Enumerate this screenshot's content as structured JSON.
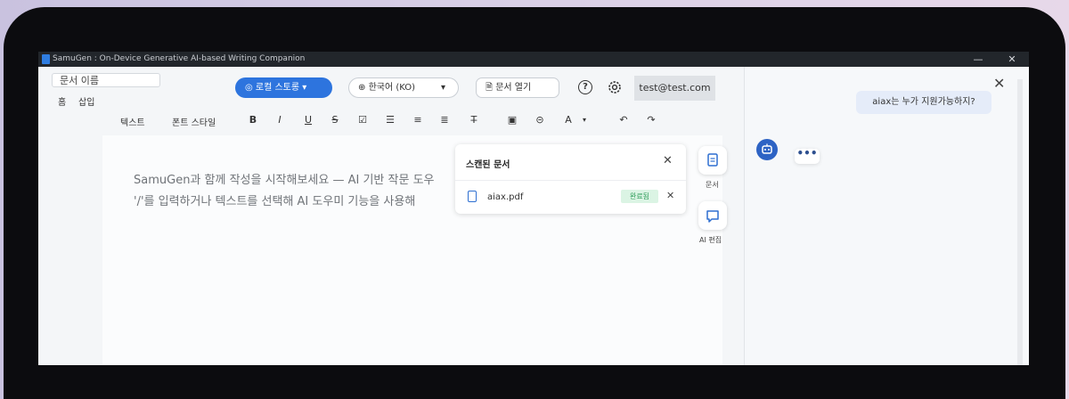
{
  "window": {
    "title": "SamuGen : On-Device Generative AI-based Writing Companion",
    "minimize": "—",
    "maximize": "⧉",
    "close": "✕"
  },
  "header": {
    "doc_name": "문서 이름",
    "menu": [
      "홈",
      "삽입"
    ],
    "storage_label": "로컬 스토롱",
    "language_label": "한국어 (KO)",
    "open_doc_label": "문서 열기",
    "help": "?",
    "account": "test@test.com"
  },
  "toolbar": {
    "text_label": "텍스트",
    "font_style_label": "폰트 스타일",
    "bold": "B",
    "italic": "I",
    "underline": "U",
    "strike": "S",
    "checkbox": "☑",
    "bullet_list": "☰",
    "numbered_list": "≡",
    "align": "≣",
    "clear_format": "T̶",
    "image": "▣",
    "link": "⊝",
    "font_color": "A",
    "undo": "↶",
    "redo": "↷"
  },
  "document": {
    "line1": "SamuGen과 함께 작성을 시작해보세요 — AI 기반 작문 도우",
    "line2": "'/'를 입력하거나 텍스트를 선택해 AI 도우미 기능을 사용해"
  },
  "scanned_panel": {
    "title": "스캔된 문서",
    "close": "✕",
    "file_name": "aiax.pdf",
    "status": "완료됨",
    "remove": "✕"
  },
  "side_tools": {
    "docs_label": "문서",
    "ai_edit_label": "AI 편집"
  },
  "chat": {
    "close": "✕",
    "user_message": "aiax는 누가 지원가능하지?",
    "typing": "•••"
  }
}
